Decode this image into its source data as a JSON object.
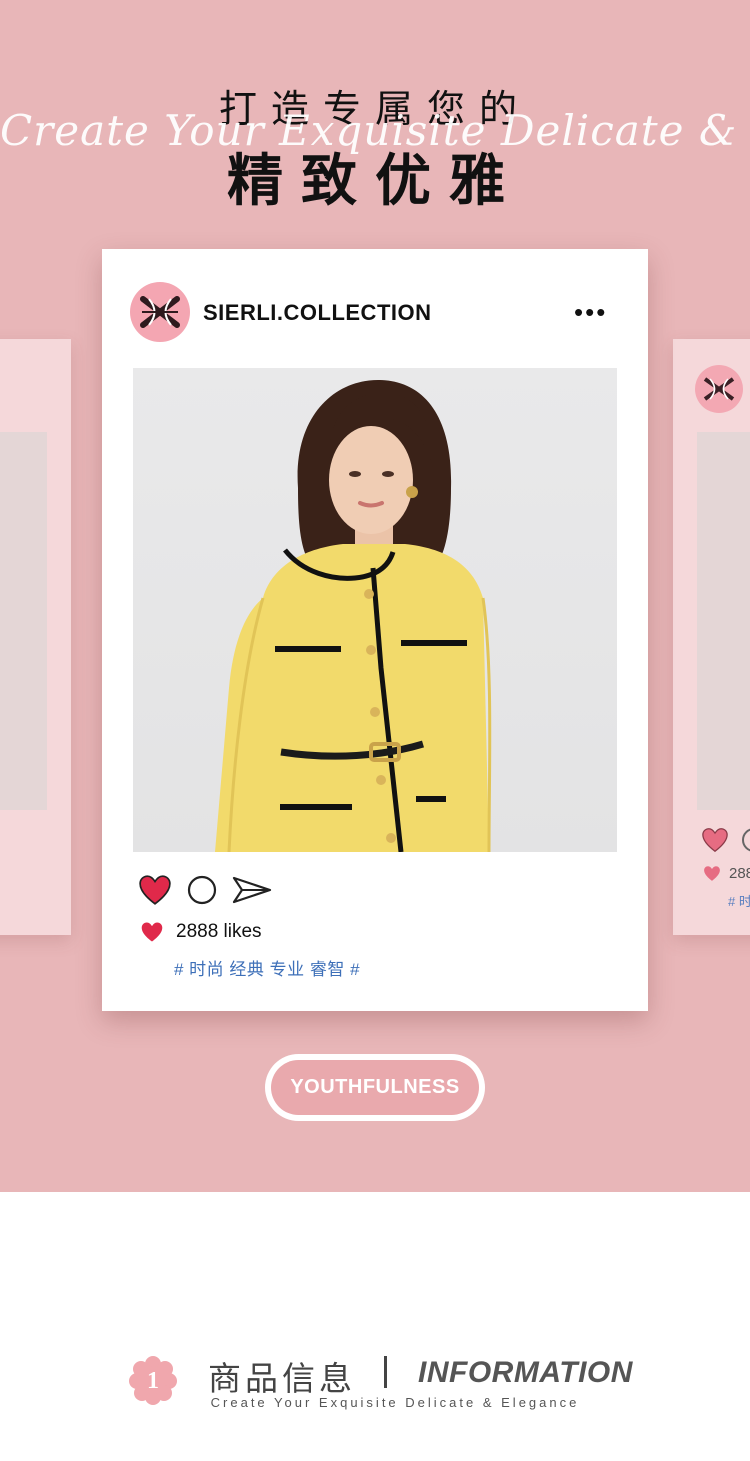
{
  "hero": {
    "title_top": "打造专属您的",
    "title_script": "Create Your Exquisite Delicate & Elegance",
    "title_main": "精致优雅"
  },
  "post": {
    "username": "SIERLI.COLLECTION",
    "more_label": "•••",
    "likes": "2888 likes",
    "tags": "# 时尚 经典 专业 睿智 #"
  },
  "side_card": {
    "likes_partial": "288",
    "tag_partial": "# 时"
  },
  "pill": {
    "label": "YOUTHFULNESS"
  },
  "info": {
    "number": "1",
    "title_cn": "商品信息",
    "title_en": "INFORMATION",
    "subtitle": "Create Your Exquisite Delicate & Elegance"
  },
  "colors": {
    "hero_bg": "#e8b6b8",
    "heart": "#e0294a",
    "tag_blue": "#3d6fb8",
    "pill": "#e9a9ad",
    "avatar_pink": "#f4a6b2",
    "jacket_yellow": "#f2da6b"
  },
  "icons": [
    "logo-icon",
    "heart-icon",
    "comment-icon",
    "send-icon",
    "more-icon",
    "flower-icon"
  ]
}
